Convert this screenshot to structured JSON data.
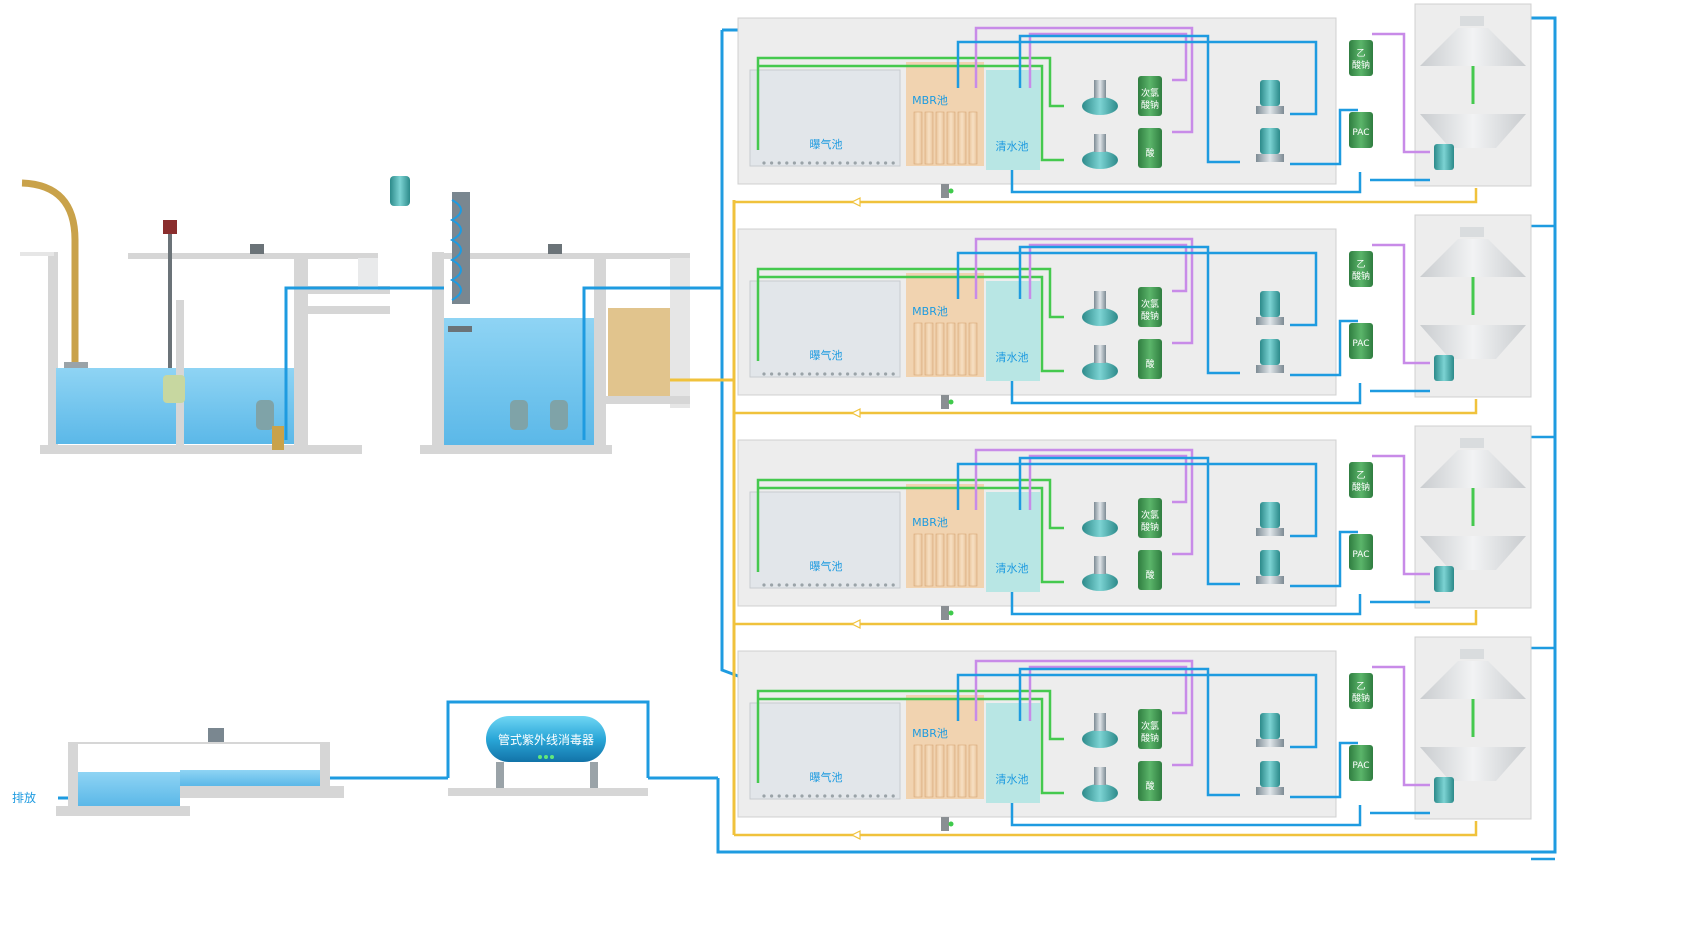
{
  "colors": {
    "water_pipe": "#1e9be0",
    "aeration_pipe": "#45c94e",
    "chemical_pipe": "#c88be8",
    "sludge_pipe": "#f0c23c",
    "water": "#7fcbef",
    "tank_wall": "#d6d6d6",
    "mbr_zone": "#f1d3b0",
    "clear_zone": "#b8e6e4",
    "drum": "#3f9a52"
  },
  "units": [
    {
      "aeration_label": "曝气池",
      "mbr_label": "MBR池",
      "clear_label": "清水池",
      "tank_a": [
        "次氯",
        "酸钠"
      ],
      "tank_b": "酸",
      "tank_c": [
        "乙",
        "酸钠"
      ],
      "tank_d": "PAC"
    },
    {
      "aeration_label": "曝气池",
      "mbr_label": "MBR池",
      "clear_label": "清水池",
      "tank_a": [
        "次氯",
        "酸钠"
      ],
      "tank_b": "酸",
      "tank_c": [
        "乙",
        "酸钠"
      ],
      "tank_d": "PAC"
    },
    {
      "aeration_label": "曝气池",
      "mbr_label": "MBR池",
      "clear_label": "清水池",
      "tank_a": [
        "次氯",
        "酸钠"
      ],
      "tank_b": "酸",
      "tank_c": [
        "乙",
        "酸钠"
      ],
      "tank_d": "PAC"
    },
    {
      "aeration_label": "曝气池",
      "mbr_label": "MBR池",
      "clear_label": "清水池",
      "tank_a": [
        "次氯",
        "酸钠"
      ],
      "tank_b": "酸",
      "tank_c": [
        "乙",
        "酸钠"
      ],
      "tank_d": "PAC"
    }
  ],
  "uv": {
    "label": "管式紫外线消毒器"
  },
  "outlet": {
    "label": "排放"
  }
}
